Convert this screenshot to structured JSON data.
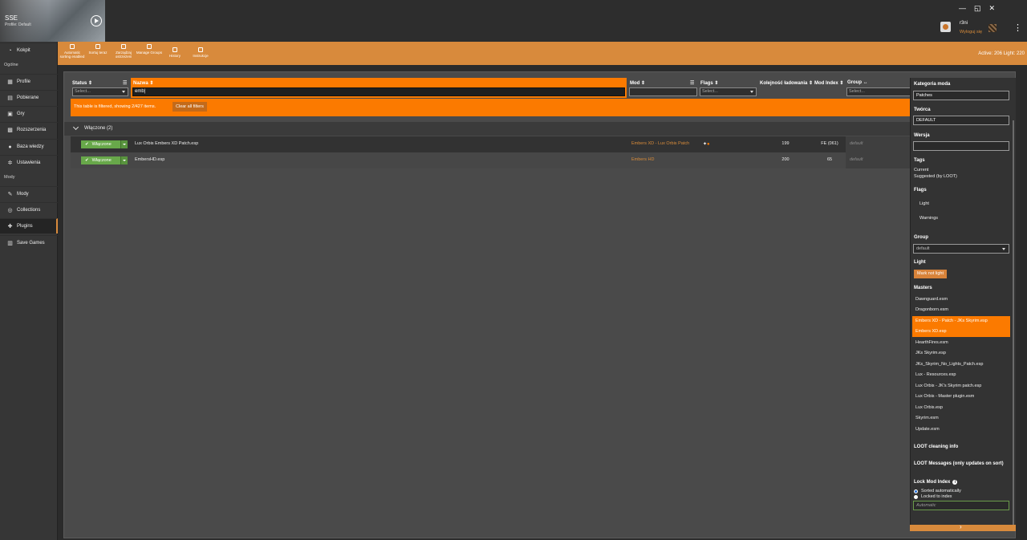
{
  "header": {
    "game_name": "SSE",
    "profile": "Profile: Default",
    "window_controls": [
      "—",
      "◱",
      "✕"
    ],
    "user_name": "r3ni",
    "logout_label": "Wyloguj się",
    "menu_glyph": "⋮"
  },
  "toolbar": {
    "buttons": [
      {
        "icon": "lock-icon",
        "label": "Automatic sorting enabled"
      },
      {
        "icon": "sort-icon",
        "label": "Sortuj teraz"
      },
      {
        "icon": "warning-icon",
        "label": "Zarządzaj ostrzeżeni"
      },
      {
        "icon": "list-icon",
        "label": "Manage Groups"
      },
      {
        "icon": "history-icon",
        "label": "History"
      },
      {
        "icon": "book-icon",
        "label": "Instrukcje"
      }
    ],
    "active_count": "Active: 206 Light: 220"
  },
  "sidebar": {
    "top_item": {
      "label": "Kokpit",
      "icon": "gauge-icon"
    },
    "sections": [
      {
        "title": "Ogólne",
        "items": [
          {
            "label": "Profile",
            "icon": "grid-icon"
          },
          {
            "label": "Pobierane",
            "icon": "download-icon"
          },
          {
            "label": "Gry",
            "icon": "gamepad-icon"
          },
          {
            "label": "Rozszerzenia",
            "icon": "puzzle-icon"
          },
          {
            "label": "Baza wiedzy",
            "icon": "knowledge-icon"
          },
          {
            "label": "Ustawienia",
            "icon": "gear-icon"
          }
        ]
      },
      {
        "title": "Mody",
        "items": [
          {
            "label": "Mody",
            "icon": "wrench-icon"
          },
          {
            "label": "Collections",
            "icon": "collection-icon"
          },
          {
            "label": "Plugins",
            "icon": "plugin-icon",
            "active": true
          },
          {
            "label": "Save Games",
            "icon": "save-icon"
          }
        ]
      }
    ]
  },
  "table": {
    "columns": {
      "status": "Status",
      "name": "Nazwa",
      "mod": "Mod",
      "flags": "Flags",
      "load_order": "Kolejność ładowania",
      "mod_index": "Mod Index",
      "group": "Group"
    },
    "filters": {
      "status_placeholder": "Select...",
      "name_value": "emb|",
      "flags_placeholder": "Select...",
      "group_placeholder": "Select..."
    },
    "filter_banner": "This table is filtered, showing 2/427 items.",
    "clear_filters": "Clear all filters",
    "group_label": "Włączone (2)",
    "rows": [
      {
        "status": "Włączone",
        "name": "Lux Orbis Embers XD Patch.esp",
        "mod": "Embers XD - Lux Orbis Patch",
        "load_order": "199",
        "mod_index": "FE (061)",
        "group": "default",
        "flags": true
      },
      {
        "status": "Włączone",
        "name": "EmbersHD.esp",
        "mod": "Embers HD",
        "load_order": "200",
        "mod_index": "65",
        "group": "default",
        "flags": false
      }
    ]
  },
  "details": {
    "category_label": "Kategoria moda",
    "category_value": "Patches",
    "author_label": "Twórca",
    "author_value": "DEFAULT",
    "version_label": "Wersja",
    "version_value": "",
    "tags_label": "Tags",
    "tags_current": "Current",
    "tags_suggested": "Suggested (by LOOT)",
    "flags_label": "Flags",
    "flag_light": "Light",
    "flag_warnings": "Warnings",
    "group_label": "Group",
    "group_value": "default",
    "light_label": "Light",
    "light_button": "Mark not light",
    "masters_label": "Masters",
    "masters": [
      {
        "name": "Dawnguard.esm",
        "highlight": false
      },
      {
        "name": "Dragonborn.esm",
        "highlight": false
      },
      {
        "name": "Embers XD - Patch - JKs Skyrim.esp",
        "highlight": true
      },
      {
        "name": "Embers XD.esp",
        "highlight": true
      },
      {
        "name": "HearthFires.esm",
        "highlight": false
      },
      {
        "name": "JKs Skyrim.esp",
        "highlight": false
      },
      {
        "name": "JKs_Skyrim_No_Lights_Patch.esp",
        "highlight": false
      },
      {
        "name": "Lux - Resources.esp",
        "highlight": false
      },
      {
        "name": "Lux Orbis - JK's Skyrim patch.esp",
        "highlight": false
      },
      {
        "name": "Lux Orbis - Master plugin.esm",
        "highlight": false
      },
      {
        "name": "Lux Orbis.esp",
        "highlight": false
      },
      {
        "name": "Skyrim.esm",
        "highlight": false
      },
      {
        "name": "Update.esm",
        "highlight": false
      }
    ],
    "loot_cleaning": "LOOT cleaning info",
    "loot_messages": "LOOT Messages (only updates on sort)",
    "lock_label": "Lock Mod Index",
    "lock_sorted": "Sorted automatically",
    "lock_locked": "Locked to index",
    "lock_placeholder": "Automatic"
  },
  "colors": {
    "accent": "#d88a3c",
    "highlight": "#fb7a00",
    "enabled_green": "#68a84a"
  }
}
